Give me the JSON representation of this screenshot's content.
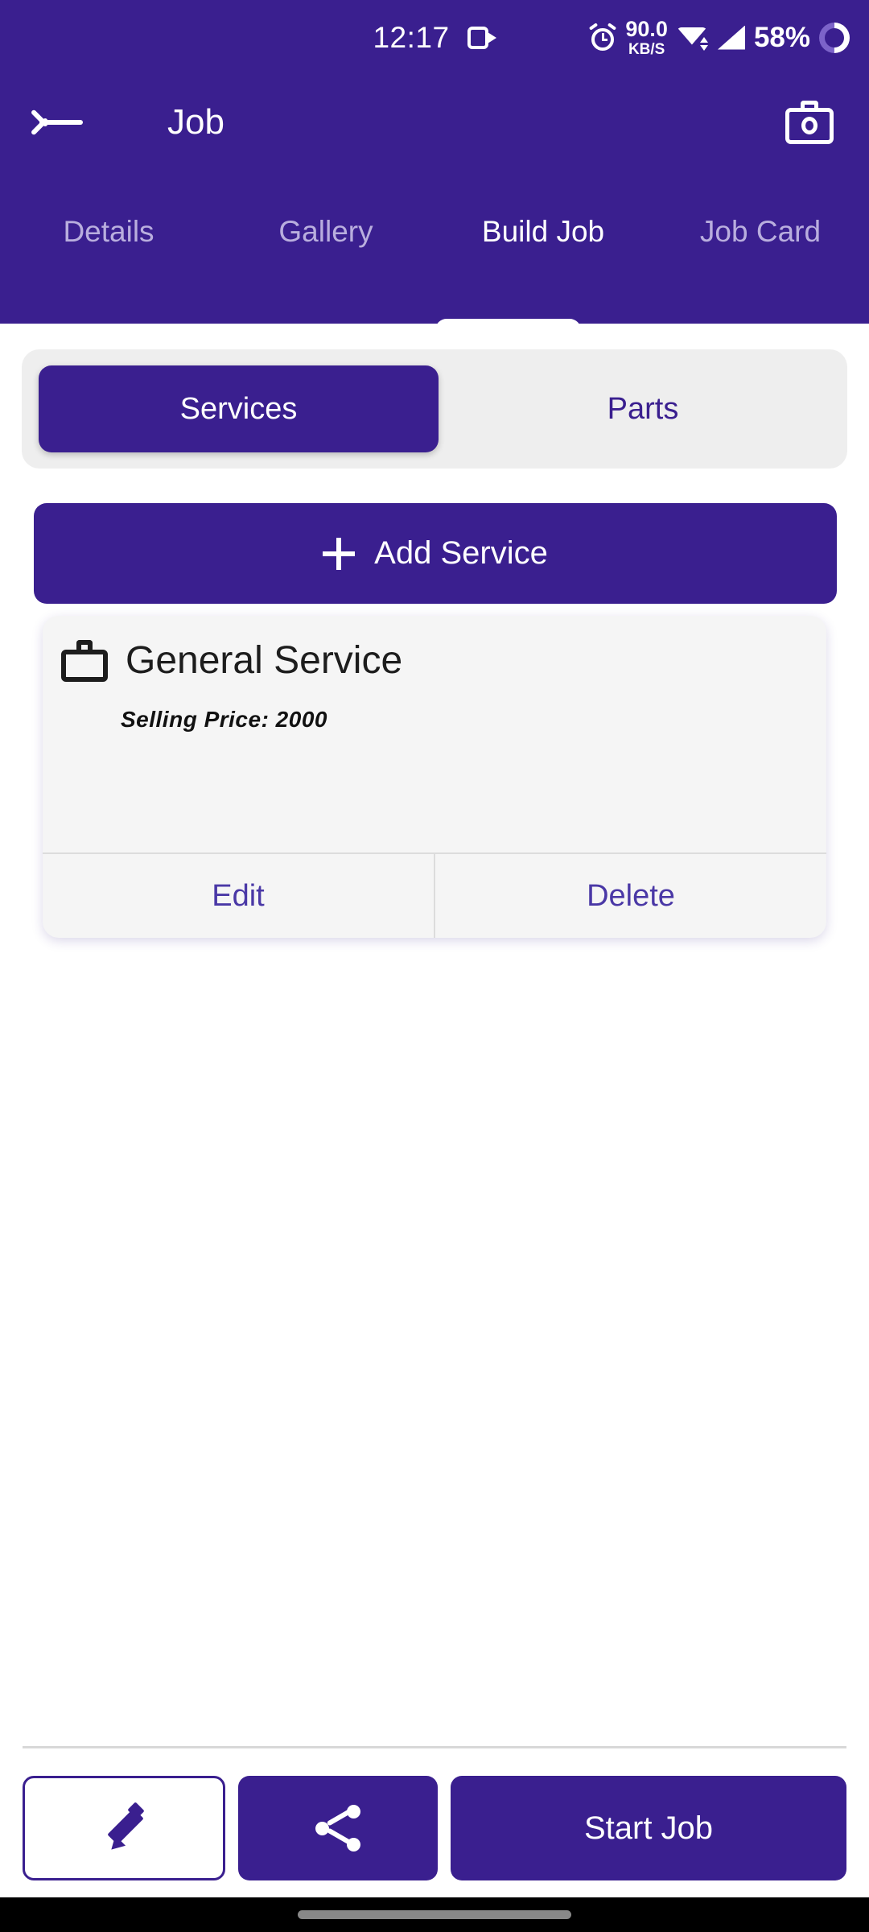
{
  "status_bar": {
    "time": "12:17",
    "video_icon": "video-camera-icon",
    "alarm_icon": "alarm-clock-icon",
    "net_speed_value": "90.0",
    "net_speed_unit": "KB/S",
    "wifi_icon": "wifi-icon",
    "signal_icon": "cellular-signal-icon",
    "battery_percent": "58%",
    "battery_icon": "battery-ring-icon"
  },
  "app_bar": {
    "back_icon": "back-arrow-icon",
    "title": "Job",
    "camera_icon": "camera-icon"
  },
  "tabs": {
    "items": [
      {
        "label": "Details",
        "active": false
      },
      {
        "label": "Gallery",
        "active": false
      },
      {
        "label": "Build Job",
        "active": true
      },
      {
        "label": "Job Card",
        "active": false
      }
    ]
  },
  "segment": {
    "services_label": "Services",
    "parts_label": "Parts",
    "selected": "Services"
  },
  "add_button": {
    "label": "Add Service",
    "icon": "plus-icon"
  },
  "service_cards": [
    {
      "icon": "briefcase-icon",
      "title": "General Service",
      "price_label": "Selling Price: 2000",
      "edit_label": "Edit",
      "delete_label": "Delete"
    }
  ],
  "bottom_bar": {
    "edit_icon": "pencil-icon",
    "share_icon": "share-icon",
    "start_label": "Start Job"
  },
  "colors": {
    "primary": "#3A1F8F",
    "tab_inactive": "#b9aede",
    "card_bg": "#f5f5f5",
    "segment_bg": "#eeeeee",
    "action_text": "#4a38a6"
  }
}
